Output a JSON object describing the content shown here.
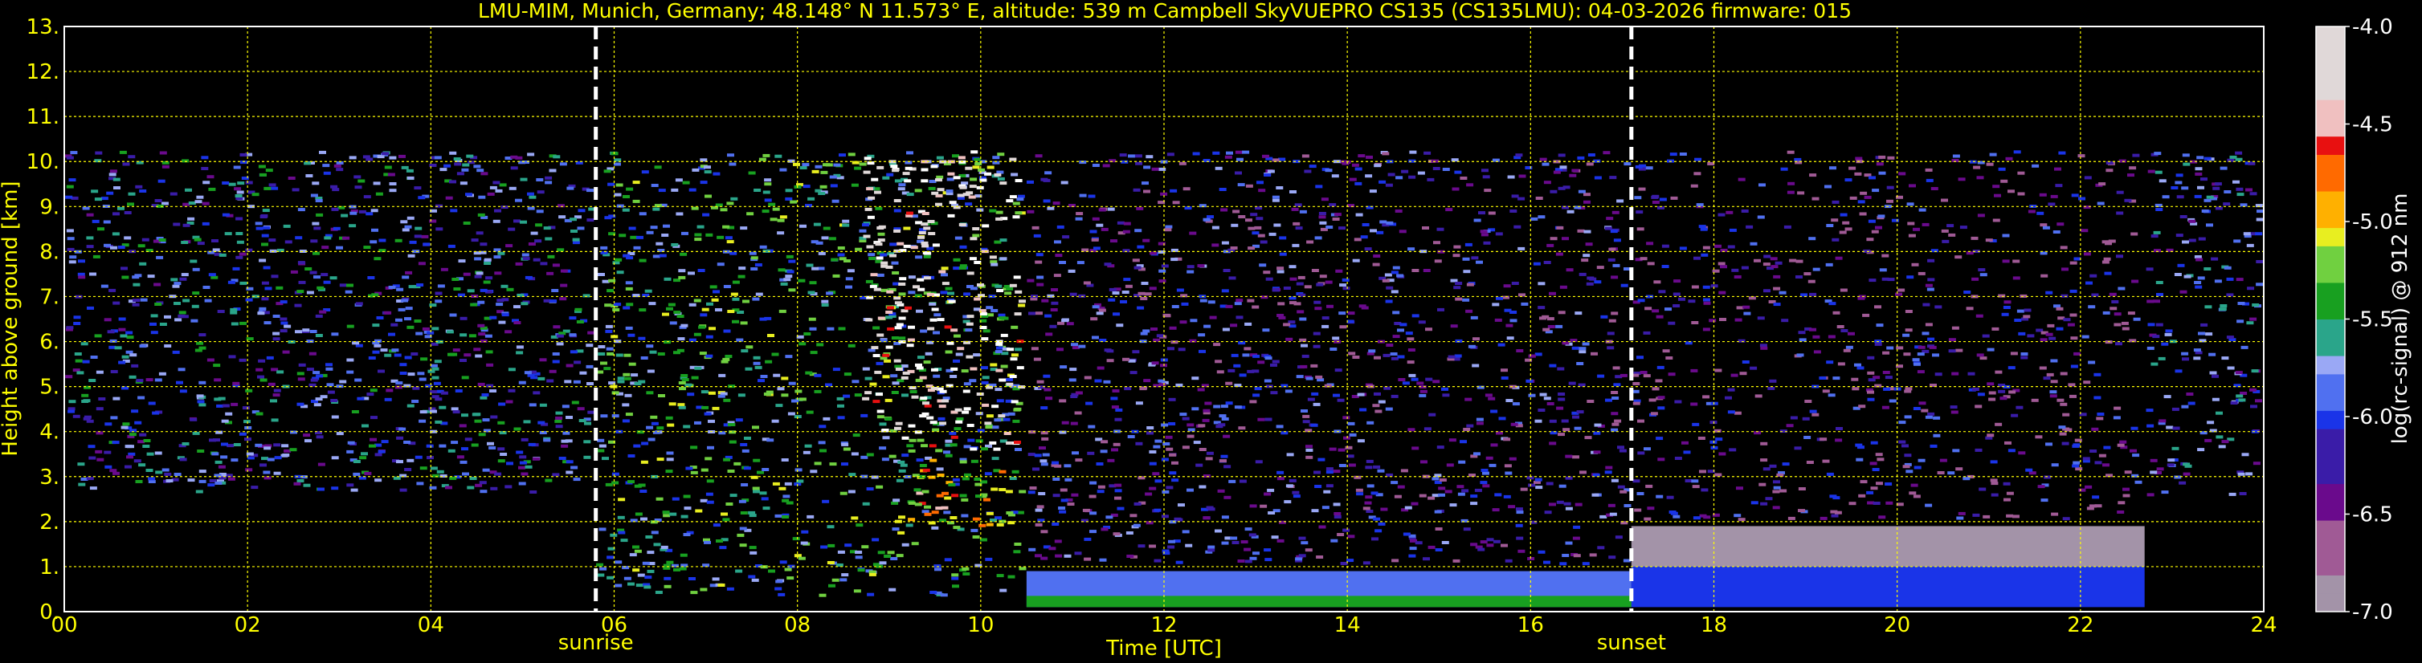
{
  "chart_data": {
    "type": "heatmap",
    "title": "LMU-MIM, Munich, Germany; 48.148° N 11.573° E, altitude: 539 m    Campbell SkyVUEPRO CS135 (CS135LMU): 04-03-2026    firmware: 015",
    "xlabel": "Time [UTC]",
    "ylabel": "Height above ground [km]",
    "colorbar_label": "log(rc-signal) @ 912 nm",
    "xlim": [
      0,
      24
    ],
    "ylim": [
      0,
      13
    ],
    "x_ticks": [
      0,
      2,
      4,
      6,
      8,
      10,
      12,
      14,
      16,
      18,
      20,
      22,
      24
    ],
    "x_tick_labels": [
      "00",
      "02",
      "04",
      "06",
      "08",
      "10",
      "12",
      "14",
      "16",
      "18",
      "20",
      "22",
      "24"
    ],
    "y_ticks": [
      0,
      1,
      2,
      3,
      4,
      5,
      6,
      7,
      8,
      9,
      10,
      11,
      12,
      13
    ],
    "y_tick_labels": [
      "0.",
      "1.",
      "2.",
      "3.",
      "4.",
      "5.",
      "6.",
      "7.",
      "8.",
      "9.",
      "10.",
      "11.",
      "12.",
      "13."
    ],
    "color_range": [
      -7.0,
      -4.0
    ],
    "colorbar_ticks": [
      -4.0,
      -4.5,
      -5.0,
      -5.5,
      -6.0,
      -6.5,
      -7.0
    ],
    "colorbar_tick_labels": [
      "-4.0",
      "-4.5",
      "-5.0",
      "-5.5",
      "-6.0",
      "-6.5",
      "-7.0"
    ],
    "grid": true,
    "markers": [
      {
        "label": "sunrise",
        "time": 5.8
      },
      {
        "label": "sunset",
        "time": 17.1
      }
    ],
    "layers": [
      {
        "start": 0.0,
        "end": 5.8,
        "bottom": 2.6,
        "top": 10.25,
        "level": -5.9,
        "density": 0.55
      },
      {
        "start": 5.8,
        "end": 10.5,
        "bottom": 0.3,
        "top": 10.25,
        "level": -5.6,
        "density": 0.5
      },
      {
        "start": 8.7,
        "end": 10.5,
        "bottom": 3.5,
        "top": 10.25,
        "level": -4.1,
        "density": 0.45
      },
      {
        "start": 9.2,
        "end": 10.3,
        "bottom": 1.8,
        "top": 3.4,
        "level": -4.9,
        "density": 0.55
      },
      {
        "start": 10.5,
        "end": 17.1,
        "bottom": 1.0,
        "top": 10.25,
        "level": -6.2,
        "density": 0.45
      },
      {
        "start": 10.5,
        "end": 17.1,
        "bottom": 0.1,
        "top": 0.9,
        "level": -5.9,
        "density": 1.0
      },
      {
        "start": 10.5,
        "end": 17.1,
        "bottom": 0.1,
        "top": 0.35,
        "level": -5.4,
        "density": 1.0
      },
      {
        "start": 17.1,
        "end": 22.7,
        "bottom": 2.0,
        "top": 10.25,
        "level": -6.3,
        "density": 0.35
      },
      {
        "start": 17.1,
        "end": 22.7,
        "bottom": 1.0,
        "top": 1.9,
        "level": -6.9,
        "density": 1.0
      },
      {
        "start": 17.1,
        "end": 22.7,
        "bottom": 0.1,
        "top": 1.0,
        "level": -6.0,
        "density": 1.0
      },
      {
        "start": 22.7,
        "end": 24.0,
        "bottom": 2.5,
        "top": 10.25,
        "level": -6.0,
        "density": 0.45
      }
    ]
  }
}
